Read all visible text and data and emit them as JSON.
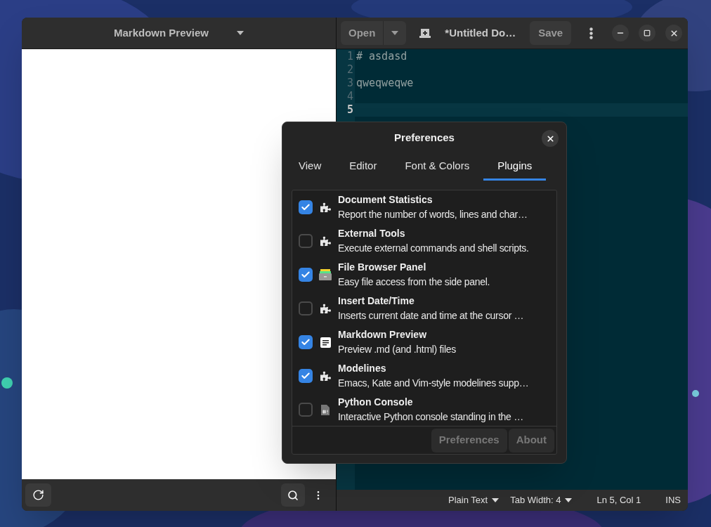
{
  "preview_pane": {
    "title": "Markdown Preview"
  },
  "editor": {
    "toolbar": {
      "open": "Open",
      "title": "*Untitled Do…",
      "save": "Save"
    },
    "lines": [
      {
        "number": "1",
        "text": "# asdasd",
        "current": false
      },
      {
        "number": "2",
        "current": false
      },
      {
        "number": "3",
        "text": "qweqweqwe",
        "current": false
      },
      {
        "number": "4",
        "current": false
      },
      {
        "number": "5",
        "current": true
      }
    ],
    "status_bar": {
      "language": "Plain Text",
      "tab_width": "Tab Width: 4",
      "position": "Ln 5, Col 1",
      "mode": "INS"
    }
  },
  "dialog": {
    "title": "Preferences",
    "tabs": [
      {
        "label": "View",
        "selected": false
      },
      {
        "label": "Editor",
        "selected": false
      },
      {
        "label": "Font & Colors",
        "selected": false
      },
      {
        "label": "Plugins",
        "selected": true
      }
    ],
    "plugins": [
      {
        "name": "Document Statistics",
        "description": "Report the number of words, lines and char…",
        "checked": true,
        "kind": "puzzle"
      },
      {
        "name": "External Tools",
        "description": "Execute external commands and shell scripts.",
        "checked": false,
        "kind": "puzzle"
      },
      {
        "name": "File Browser Panel",
        "description": "Easy file access from the side panel.",
        "checked": true,
        "kind": "cabinet"
      },
      {
        "name": "Insert Date/Time",
        "description": "Inserts current date and time at the cursor …",
        "checked": false,
        "kind": "puzzle"
      },
      {
        "name": "Markdown Preview",
        "description": "Preview .md (and .html) files",
        "checked": true,
        "kind": "document"
      },
      {
        "name": "Modelines",
        "description": "Emacs, Kate and Vim-style modelines supp…",
        "checked": true,
        "kind": "puzzle"
      },
      {
        "name": "Python Console",
        "description": "Interactive Python console standing in the …",
        "checked": false,
        "kind": "script"
      }
    ],
    "buttons": [
      {
        "label": "Preferences",
        "disabled": true
      },
      {
        "label": "About",
        "disabled": true
      }
    ]
  }
}
